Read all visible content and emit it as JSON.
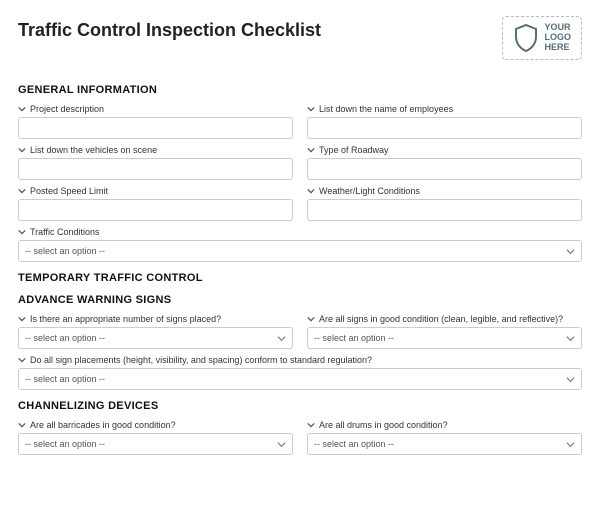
{
  "title": "Traffic Control Inspection Checklist",
  "logo": {
    "line1": "YOUR",
    "line2": "LOGO",
    "line3": "HERE"
  },
  "select_placeholder": "-- select an option --",
  "sections": {
    "general": {
      "heading": "GENERAL INFORMATION",
      "project_description": "Project description",
      "employees": "List down the name of employees",
      "vehicles": "List down the vehicles on scene",
      "roadway_type": "Type of Roadway",
      "speed_limit": "Posted Speed Limit",
      "weather": "Weather/Light Conditions",
      "traffic_conditions": "Traffic Conditions"
    },
    "temporary": {
      "heading": "TEMPORARY TRAFFIC CONTROL"
    },
    "advance": {
      "heading": "ADVANCE WARNING SIGNS",
      "signs_number": "Is there an appropriate number of signs placed?",
      "signs_condition": "Are all signs in good condition (clean, legible, and reflective)?",
      "signs_placement": "Do all sign placements (height, visibility, and spacing) conform to standard regulation?"
    },
    "channelizing": {
      "heading": "CHANNELIZING DEVICES",
      "barricades": "Are all barricades in good condition?",
      "drums": "Are all drums in good condition?"
    }
  }
}
